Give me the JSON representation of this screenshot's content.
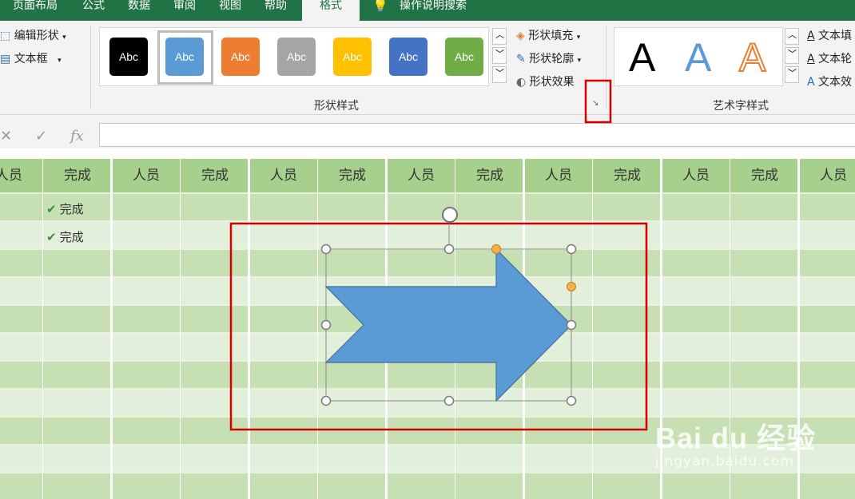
{
  "tabs": [
    {
      "label": "页面布局"
    },
    {
      "label": "公式"
    },
    {
      "label": "数据"
    },
    {
      "label": "审阅"
    },
    {
      "label": "视图"
    },
    {
      "label": "帮助"
    },
    {
      "label": "格式"
    }
  ],
  "tell_me": "操作说明搜索",
  "ribbon": {
    "edit_shape": "编辑形状",
    "text_box": "文本框",
    "styles": [
      "Abc",
      "Abc",
      "Abc",
      "Abc",
      "Abc",
      "Abc",
      "Abc"
    ],
    "style_colors": [
      "#000000",
      "#5b9bd5",
      "#ed7d31",
      "#a5a5a5",
      "#ffc000",
      "#4472c4",
      "#70ad47"
    ],
    "shape_fill": "形状填充",
    "shape_outline": "形状轮廓",
    "shape_effect": "形状效果",
    "shape_styles_label": "形状样式",
    "wordart_label": "艺术字样式",
    "wordart_letters": [
      "A",
      "A",
      "A"
    ],
    "text_fill": "文本填",
    "text_outline": "文本轮",
    "text_effect": "文本效"
  },
  "formula": {
    "cancel": "✕",
    "enter": "✓",
    "fx": "fx"
  },
  "grid": {
    "headers": [
      "人员",
      "完成",
      "人员",
      "完成",
      "人员",
      "完成",
      "人员",
      "完成",
      "人员",
      "完成",
      "人员",
      "完成",
      "人员"
    ],
    "rows": [
      {
        "col2": "完成"
      },
      {
        "col2": "完成"
      }
    ]
  },
  "watermark": {
    "brand": "Bai du 经验",
    "url": "jingyan.baidu.com"
  },
  "colors": {
    "accent": "#217346",
    "header": "#a8d08d",
    "arrow_fill": "#5b9bd5",
    "highlight": "#d40000"
  }
}
